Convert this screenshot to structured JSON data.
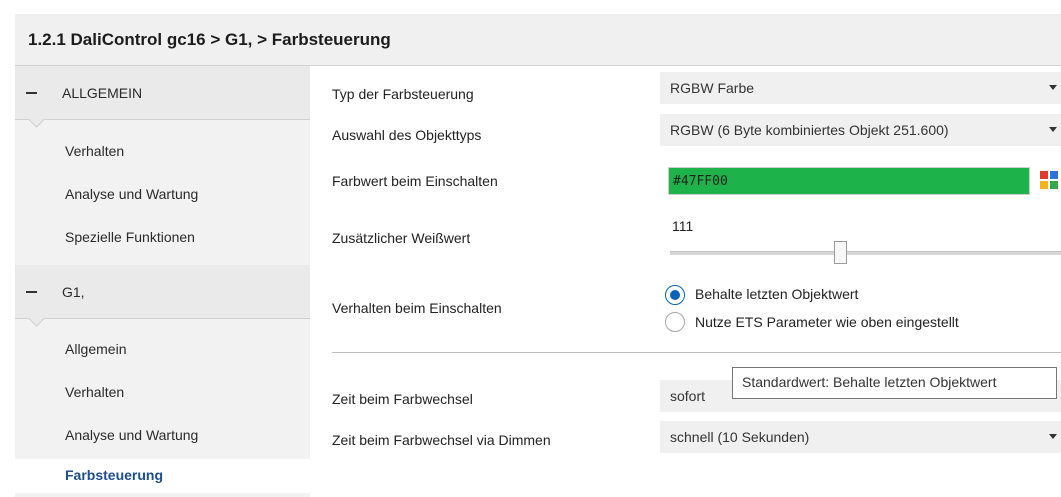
{
  "window": {
    "title": "1.2.1 DaliControl gc16 > G1,  > Farbsteuerung"
  },
  "sidebar": {
    "groups": [
      {
        "label": "ALLGEMEIN",
        "items": [
          "Verhalten",
          "Analyse und Wartung",
          "Spezielle Funktionen"
        ]
      },
      {
        "label": "G1,",
        "items": [
          "Allgemein",
          "Verhalten",
          "Analyse und Wartung",
          "Farbsteuerung"
        ]
      }
    ],
    "active_item": "Farbsteuerung"
  },
  "params": {
    "typ": {
      "label": "Typ der Farbsteuerung",
      "value": "RGBW Farbe"
    },
    "objekttyp": {
      "label": "Auswahl des Objekttyps",
      "value": "RGBW (6 Byte kombiniertes Objekt 251.600)"
    },
    "farbwert": {
      "label": "Farbwert beim Einschalten",
      "value": "#47FF00",
      "swatch_color": "#1db24a"
    },
    "weisswert": {
      "label": "Zusätzlicher Weißwert",
      "value": "111",
      "level_fraction": 0.435
    },
    "verhalten": {
      "label": "Verhalten beim Einschalten",
      "options": [
        "Behalte letzten Objektwert",
        "Nutze ETS Parameter wie oben eingestellt"
      ],
      "selected": "Behalte letzten Objektwert"
    },
    "zeit": {
      "label": "Zeit beim Farbwechsel",
      "value": "sofort"
    },
    "zeit_dimmen": {
      "label": "Zeit beim Farbwechsel via Dimmen",
      "value": "schnell (10 Sekunden)"
    }
  },
  "tooltip": {
    "text": "Standardwert: Behalte letzten Objektwert"
  },
  "colors": {
    "accent": "#0a63b8",
    "active_nav": "#1f4e8c"
  },
  "icons": {
    "collapse": "minus-icon",
    "dropdown": "chevron-down-icon",
    "picker": "color-picker-icon"
  }
}
